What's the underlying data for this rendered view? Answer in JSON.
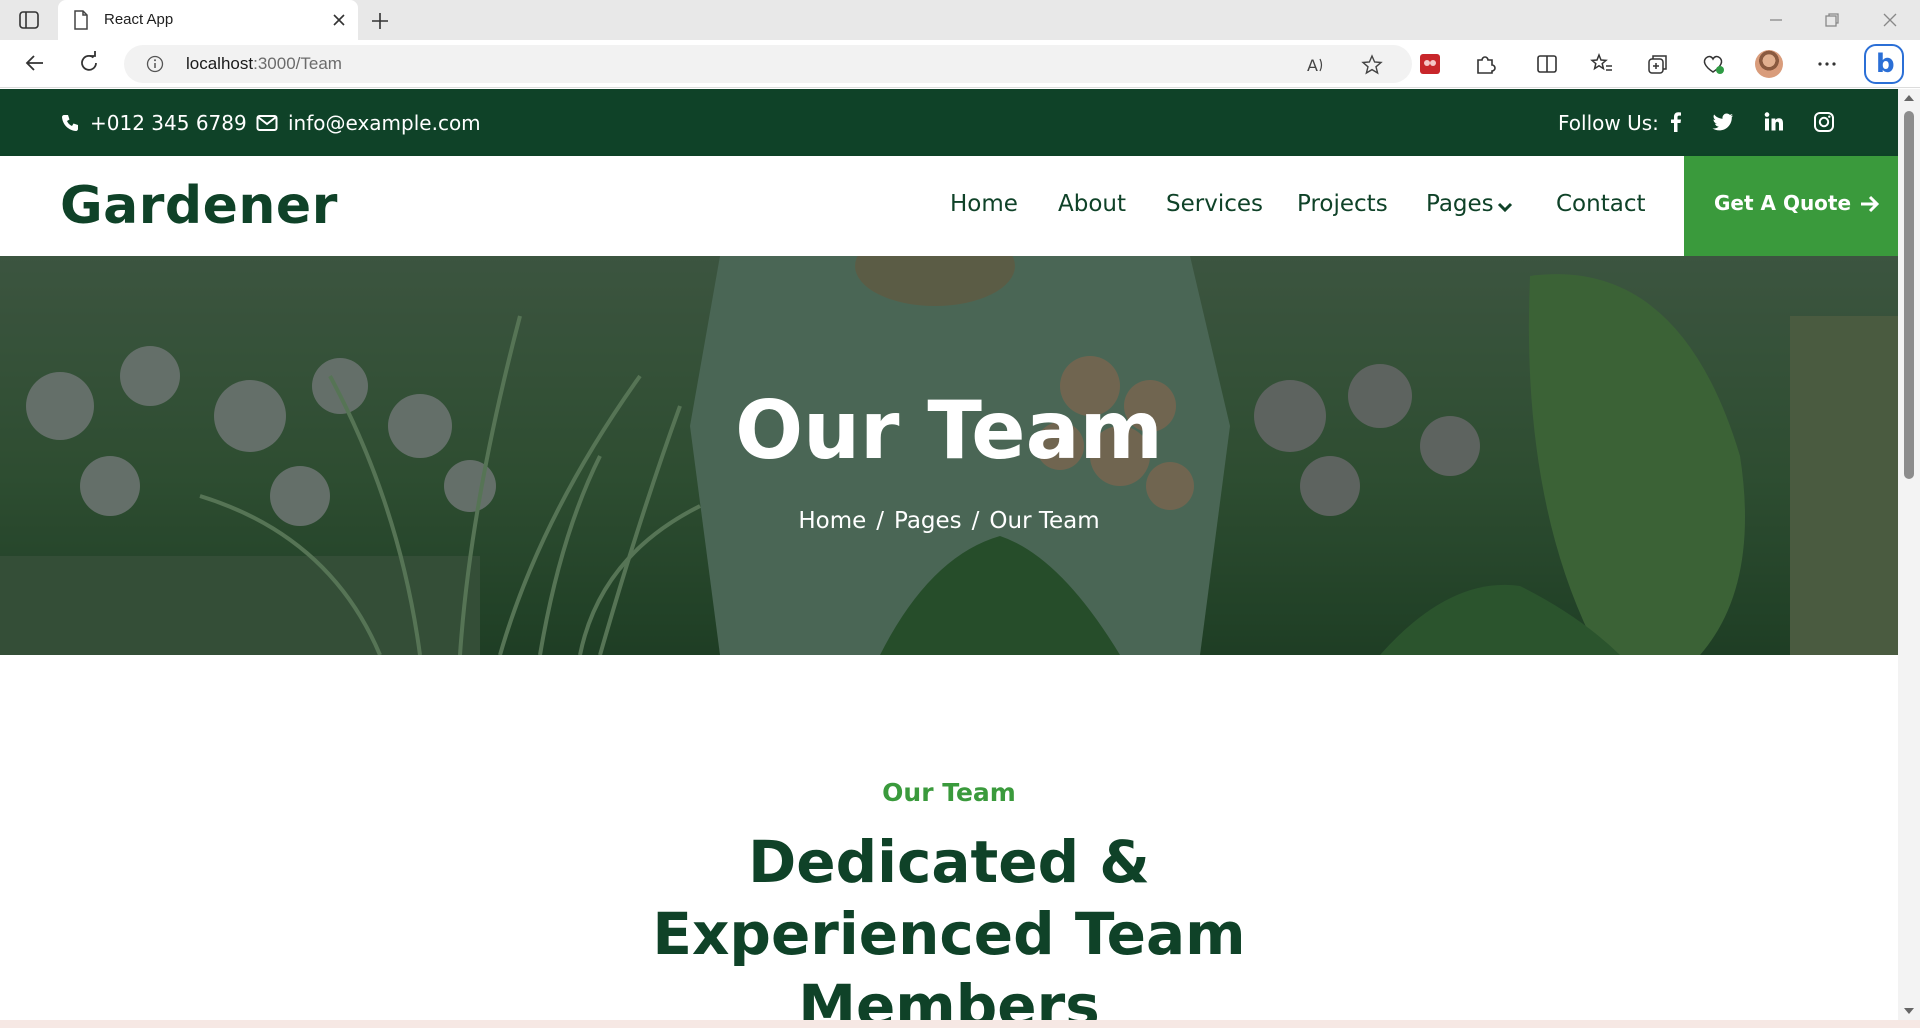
{
  "browser": {
    "tab_title": "React App",
    "url_host": "localhost",
    "url_path": ":3000/Team"
  },
  "topbar": {
    "phone": "+012 345 6789",
    "email": "info@example.com",
    "follow_label": "Follow Us:",
    "social_icons": [
      "facebook-icon",
      "twitter-icon",
      "linkedin-icon",
      "instagram-icon"
    ]
  },
  "navbar": {
    "brand": "Gardener",
    "links": [
      "Home",
      "About",
      "Services",
      "Projects",
      "Pages",
      "Contact"
    ],
    "quote_button": "Get A Quote"
  },
  "hero": {
    "title": "Our Team",
    "breadcrumb": [
      "Home",
      "Pages",
      "Our Team"
    ],
    "separator": "/"
  },
  "section": {
    "eyebrow": "Our Team",
    "title": "Dedicated & Experienced Team Members"
  },
  "colors": {
    "primary_dark": "#0f4228",
    "accent_green": "#3a9a3c",
    "white": "#ffffff"
  }
}
